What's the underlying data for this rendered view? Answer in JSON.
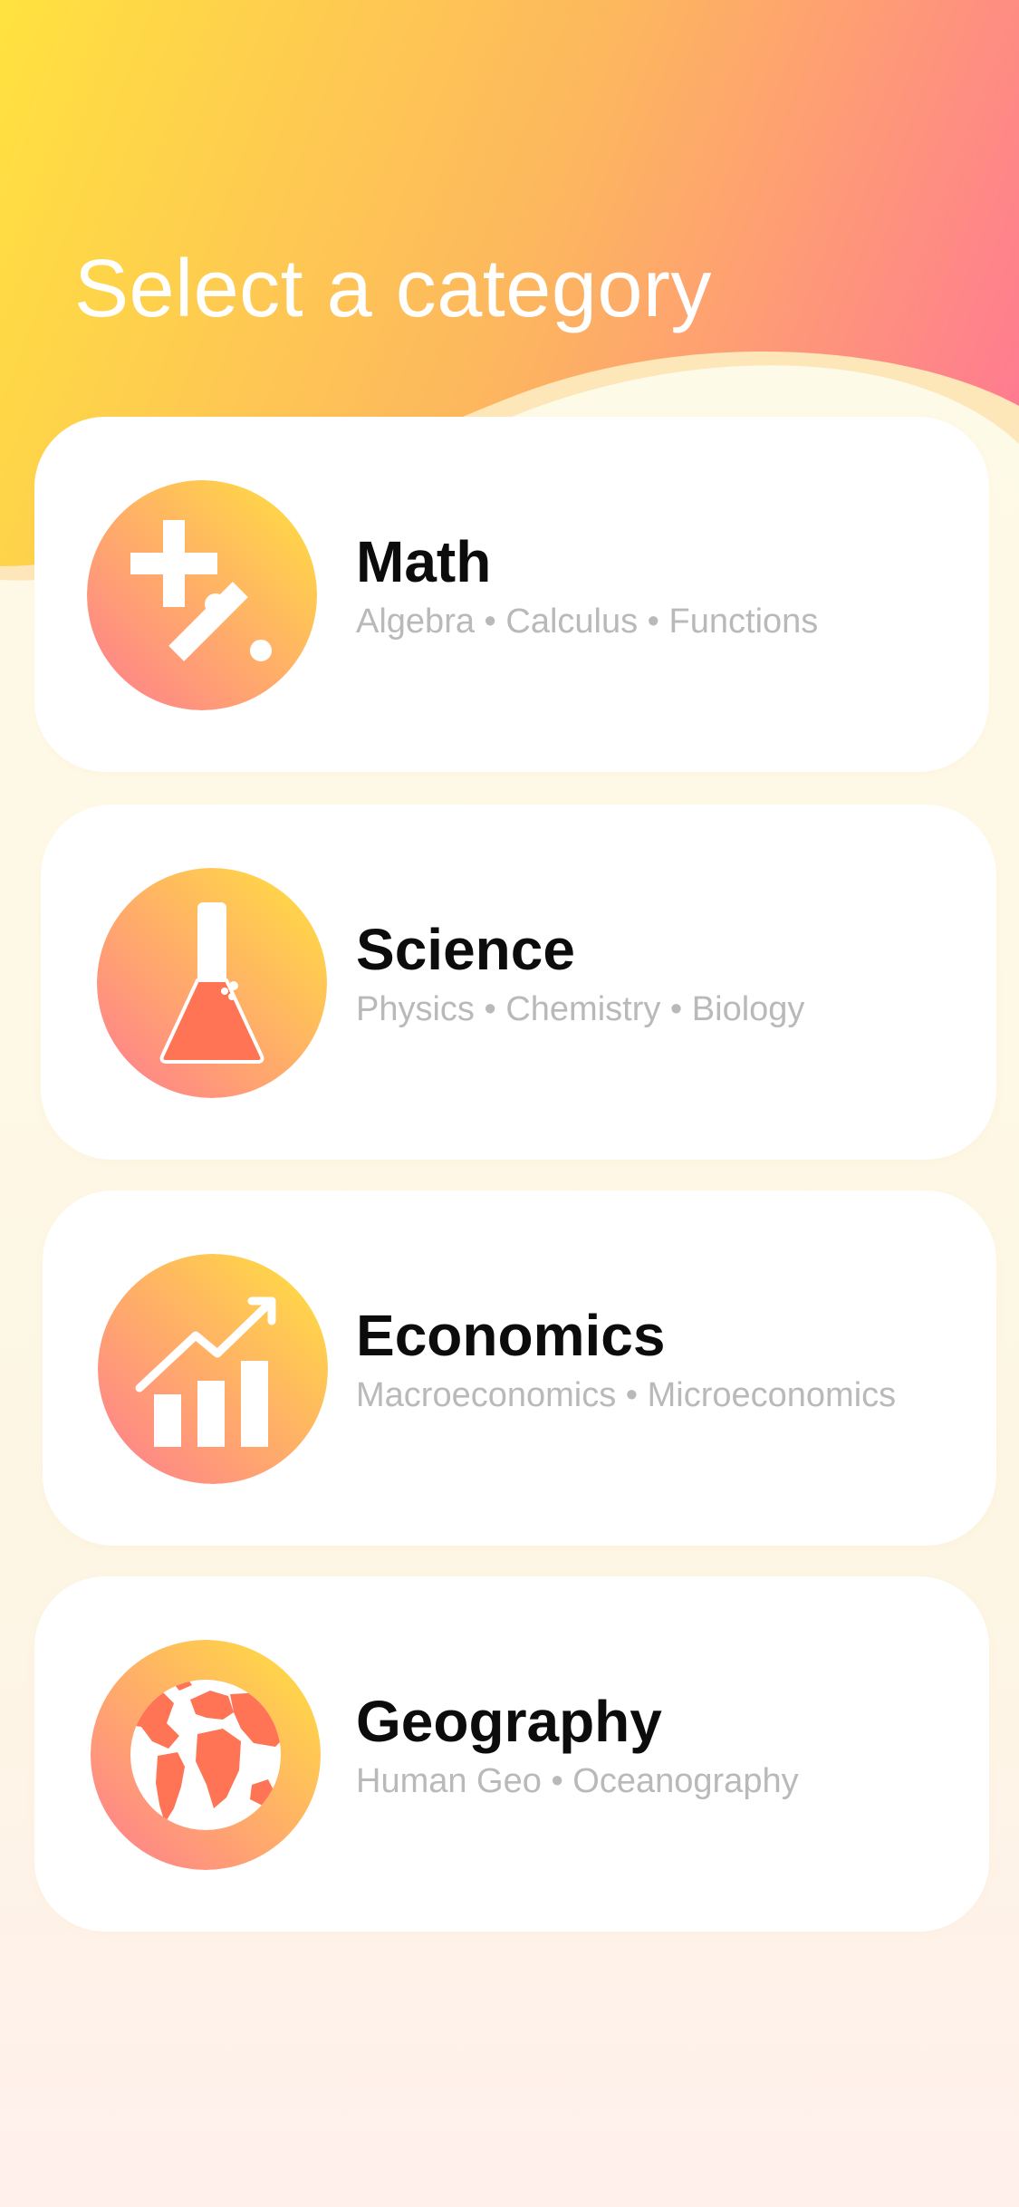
{
  "header": {
    "title": "Select a category"
  },
  "theme": {
    "gradient_start": "#ffe23f",
    "gradient_mid": "#fdb65f",
    "gradient_end": "#ff7c90",
    "icon_accent": "#ff7455",
    "title_color": "#0c0c0c",
    "subtitle_color": "#b9b9b9",
    "card_background": "#ffffff"
  },
  "categories": [
    {
      "name": "Math",
      "topics": "Algebra • Calculus • Functions",
      "icon": "plus-percent-icon"
    },
    {
      "name": "Science",
      "topics": "Physics • Chemistry • Biology",
      "icon": "flask-icon"
    },
    {
      "name": "Economics",
      "topics": "Macroeconomics • Microeconomics",
      "icon": "growth-chart-icon"
    },
    {
      "name": "Geography",
      "topics": "Human Geo • Oceanography",
      "icon": "globe-icon"
    }
  ]
}
